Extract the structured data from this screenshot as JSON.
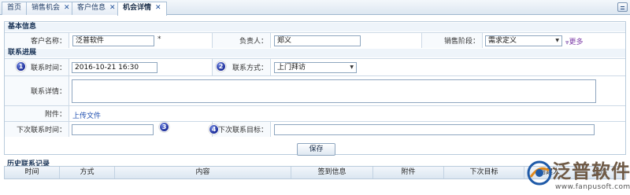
{
  "tabs": [
    {
      "label": "首页",
      "closable": false,
      "active": false
    },
    {
      "label": "销售机会",
      "closable": true,
      "active": false
    },
    {
      "label": "客户信息",
      "closable": true,
      "active": false
    },
    {
      "label": "机会详情",
      "closable": true,
      "active": true
    }
  ],
  "sections": {
    "basic": "基本信息",
    "progress": "联系进展"
  },
  "basic": {
    "customer_label": "客户名称：",
    "customer_value": "泛普软件",
    "required_mark": "*",
    "owner_label": "负责人：",
    "owner_value": "郑义",
    "stage_label": "销售阶段：",
    "stage_value": "需求定义",
    "more_label": "更多",
    "more_icon": "chevron-double-down-icon"
  },
  "progress": {
    "time_label": "联系时间：",
    "time_value": "2016-10-21 16:30",
    "method_label": "联系方式：",
    "method_value": "上门拜访",
    "detail_label": "联系详情：",
    "attach_label": "附件：",
    "attach_link": "上传文件",
    "next_time_label": "下次联系时间：",
    "next_goal_label": "下次联系目标：",
    "badges": [
      "1",
      "2",
      "3",
      "4"
    ]
  },
  "save_label": "保存",
  "history": {
    "title": "历史联系记录",
    "columns": [
      "时间",
      "方式",
      "内容",
      "签到信息",
      "附件",
      "下次目标",
      "创建人",
      "操作"
    ]
  },
  "watermark": {
    "brand": "泛普软件",
    "url": "www.fanpusoft.com"
  },
  "colors": {
    "header_bg": "#eef4fa",
    "border": "#ccd9e6",
    "link": "#1f4fb0",
    "badge": "#1e2f9a",
    "watermark": "#6f5a46"
  }
}
